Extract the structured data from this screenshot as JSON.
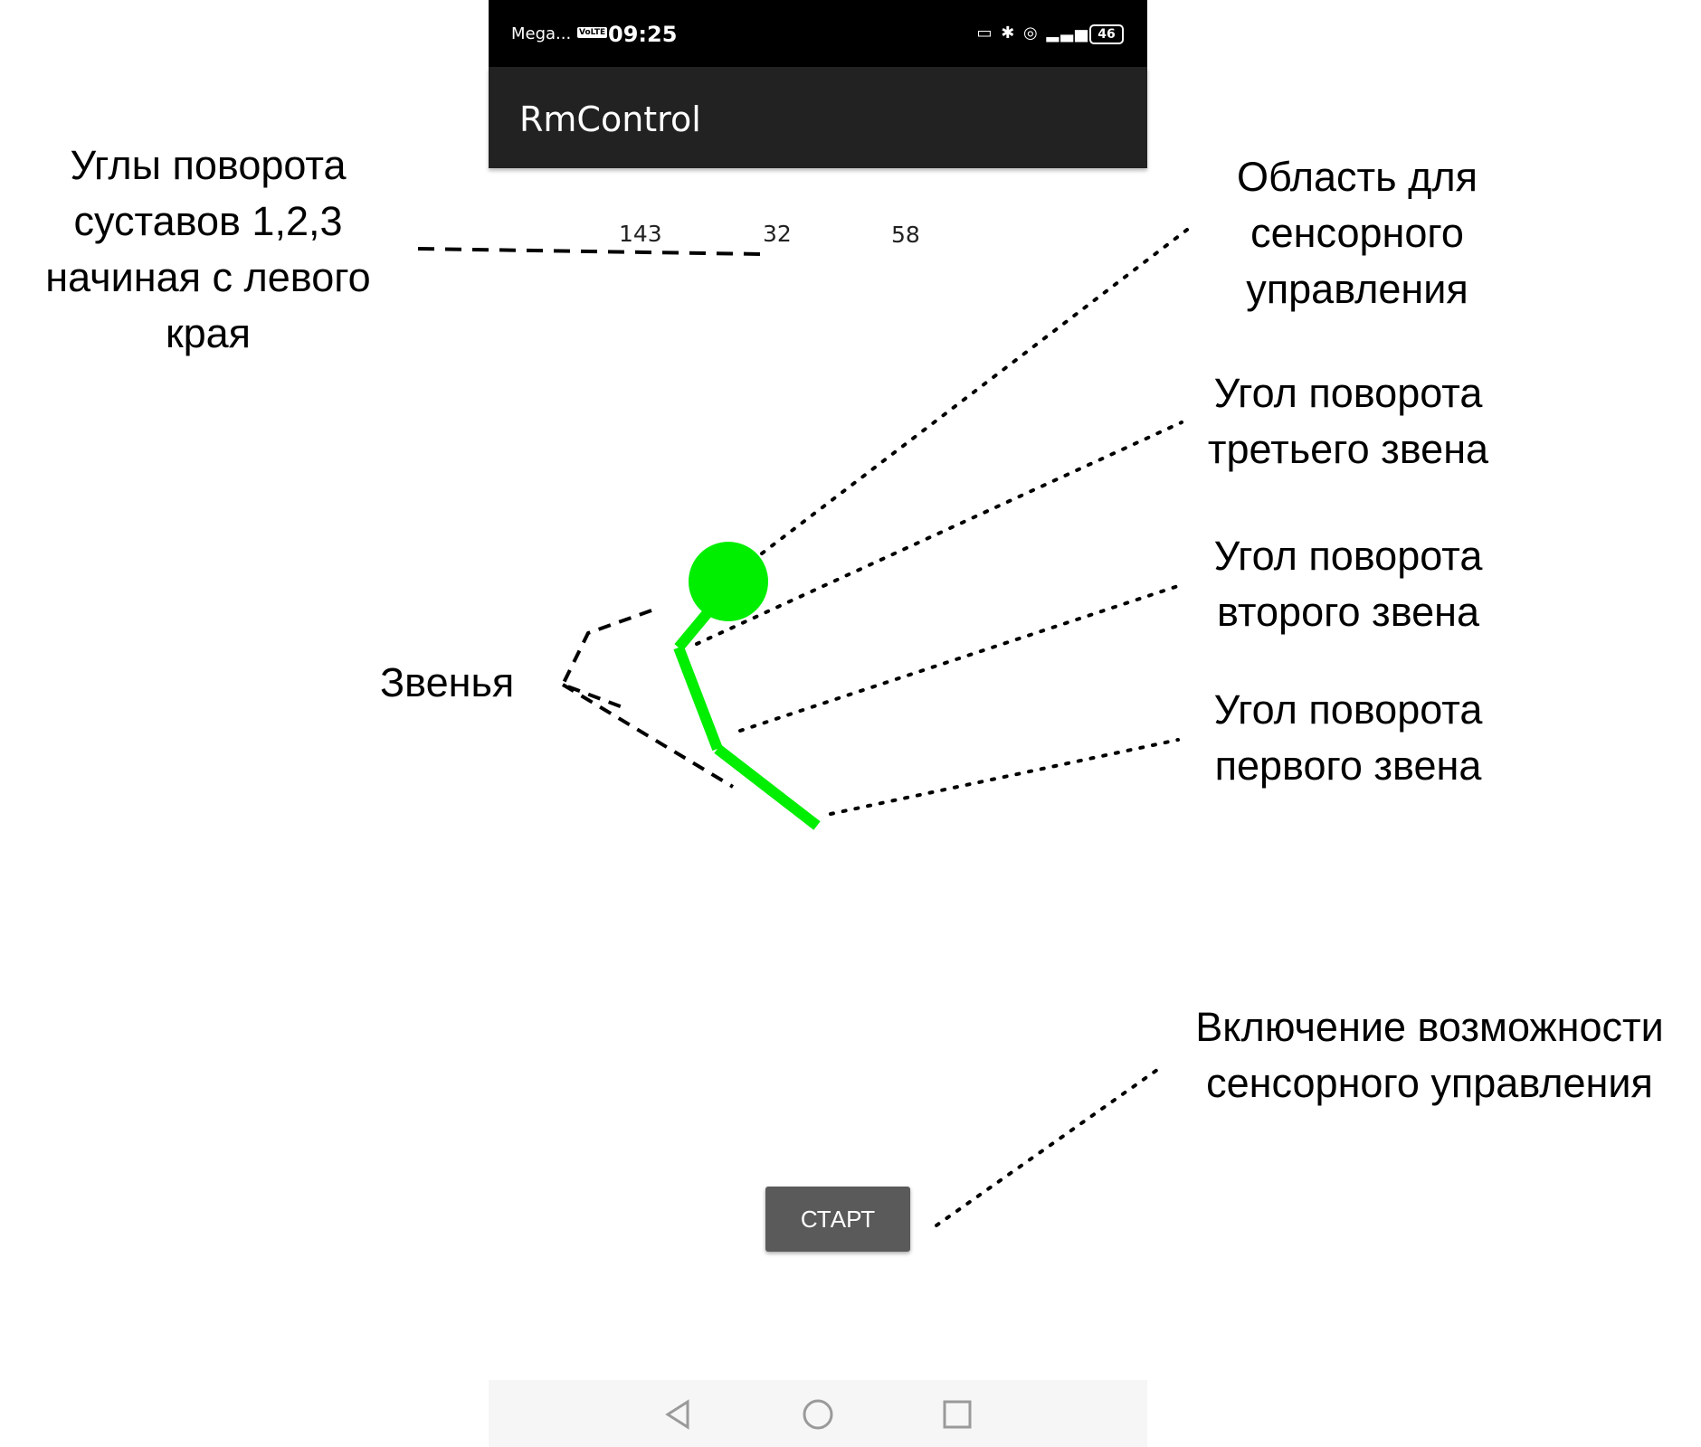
{
  "status_bar": {
    "carrier": "Mega...",
    "volte": "VoLTE",
    "time": "09:25",
    "battery": "46"
  },
  "app_bar": {
    "title": "RmControl"
  },
  "joint_angles": {
    "first": "143",
    "second": "32",
    "third": "58"
  },
  "start_button": {
    "label": "СТАРТ"
  },
  "colors": {
    "arm": "#00ee00",
    "app_bar": "#222222",
    "button": "#5a5a5a"
  },
  "annotations": {
    "joint_angles": [
      "Углы поворота",
      "суставов 1,2,3",
      "начиная с левого",
      "края"
    ],
    "touch_area": [
      "Область для",
      "сенсорного",
      "управления"
    ],
    "third_link_angle": [
      "Угол поворота",
      "третьего звена"
    ],
    "second_link_angle": [
      "Угол поворота",
      "второго звена"
    ],
    "first_link_angle": [
      "Угол поворота",
      "первого звена"
    ],
    "links": "Звенья",
    "touch_enable": [
      "Включение возможности",
      "сенсорного управления"
    ]
  },
  "nav_icons": [
    "back-icon",
    "home-icon",
    "recents-icon"
  ]
}
